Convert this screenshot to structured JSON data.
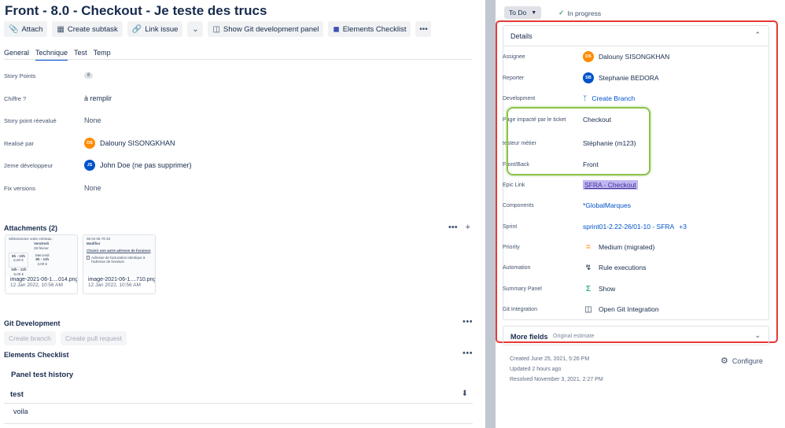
{
  "issue": {
    "title": "Front - 8.0 - Checkout - Je teste des trucs"
  },
  "toolbar": {
    "attach": "Attach",
    "create_subtask": "Create subtask",
    "link_issue": "Link issue",
    "show_git": "Show Git development panel",
    "elements_checklist": "Elements Checklist"
  },
  "tabs": [
    "General",
    "Technique",
    "Test",
    "Temp"
  ],
  "fields": {
    "story_points": {
      "label": "Story Points",
      "value": "8"
    },
    "chiffre": {
      "label": "Chiffre ?",
      "value": "à remplir"
    },
    "story_point_reevalue": {
      "label": "Story point réevalué",
      "value": "None"
    },
    "realise_par": {
      "label": "Realisé par",
      "value": "Dalouny SISONGKHAN",
      "initials": "DS"
    },
    "deuxieme_dev": {
      "label": "2eme développeur",
      "value": "John Doe (ne pas supprimer)",
      "initials": "JS"
    },
    "fix_versions": {
      "label": "Fix versions",
      "value": "None"
    }
  },
  "attachments": {
    "title": "Attachments (2)",
    "items": [
      {
        "name": "image-2021-06-1....014.png",
        "date": "12 Jan 2022, 10:56 AM",
        "thumb_lines": [
          "Sélectionnez votre créneau :",
          "Vendredi",
          "28 février",
          "8h - 10h",
          "6,00 €",
          "Mercredi",
          "8h - 11h",
          "3,00 €",
          "10h - 12h",
          "6,00 €"
        ]
      },
      {
        "name": "image-2021-06-1....710.png",
        "date": "12 Jan 2022, 10:56 AM",
        "thumb_lines": [
          "06 04 05 78 33",
          "Modifier",
          "Choisir une autre adresse de livraison",
          "Adresse de facturation identique à l'adresse de livraison"
        ]
      }
    ]
  },
  "git": {
    "title": "Git Development",
    "create_branch": "Create branch",
    "create_pr": "Create pull request"
  },
  "checklist": {
    "title": "Elements Checklist",
    "panel": "Panel test history",
    "row": "test",
    "item": "voila"
  },
  "status": {
    "current": "To Do",
    "next": "In progress"
  },
  "details": {
    "title": "Details",
    "assignee": {
      "label": "Assignee",
      "value": "Dalouny SISONGKHAN",
      "initials": "DS"
    },
    "reporter": {
      "label": "Reporter",
      "value": "Stephanie BEDORA",
      "initials": "SB"
    },
    "development": {
      "label": "Development",
      "value": "Create Branch"
    },
    "page_impacte": {
      "label": "Page impacté par le ticket",
      "value": "Checkout"
    },
    "testeur_metier": {
      "label": "testeur métier",
      "value": "Stéphanie (m123)"
    },
    "front_back": {
      "label": "Front/Back",
      "value": "Front"
    },
    "epic_link": {
      "label": "Epic Link",
      "value": "SFRA - Checkout"
    },
    "components": {
      "label": "Components",
      "value": "*GlobalMarques"
    },
    "sprint": {
      "label": "Sprint",
      "value": "sprint01-2.22-26/01-10 - SFRA",
      "extra": "+3"
    },
    "priority": {
      "label": "Priority",
      "value": "Medium (migrated)"
    },
    "automation": {
      "label": "Automation",
      "value": "Rule executions"
    },
    "summary_panel": {
      "label": "Summary Panel",
      "value": "Show"
    },
    "git_integration": {
      "label": "Git Integration",
      "value": "Open Git Integration"
    }
  },
  "more_fields": {
    "title": "More fields",
    "subtitle": "Original estimate"
  },
  "meta": {
    "created": "Created June 25, 2021, 5:26 PM",
    "updated": "Updated 2 hours ago",
    "resolved": "Resolved November 3, 2021, 2:27 PM",
    "configure": "Configure"
  },
  "colors": {
    "accent": "#0052cc",
    "red_highlight": "#e53935",
    "green_highlight": "#8bc34a",
    "epic_tag": "#c0b6f2"
  }
}
